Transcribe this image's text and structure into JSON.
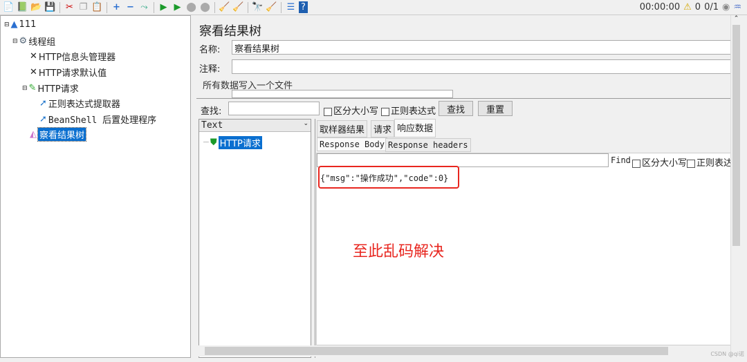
{
  "toolbar": {
    "icons": [
      "new-icon",
      "templates-icon",
      "open-icon",
      "save-icon",
      "cut-icon",
      "copy-icon",
      "paste-icon",
      "expand-icon",
      "collapse-icon",
      "toggle-icon",
      "start-icon",
      "start-no-pause-icon",
      "stop-icon",
      "shutdown-icon",
      "clear-icon",
      "clear-all-icon",
      "search-icon",
      "reset-search-icon",
      "function-helper-icon",
      "help-icon"
    ],
    "timer": "00:00:00",
    "warnings": "0",
    "threads": "0/1"
  },
  "tree": {
    "items": [
      {
        "label": "111",
        "icon": "test-plan-icon"
      },
      {
        "label": "线程组",
        "icon": "thread-group-icon"
      },
      {
        "label": "HTTP信息头管理器",
        "icon": "config-tool-icon"
      },
      {
        "label": "HTTP请求默认值",
        "icon": "config-tool-icon"
      },
      {
        "label": "HTTP请求",
        "icon": "sampler-icon"
      },
      {
        "label": "正则表达式提取器",
        "icon": "post-processor-icon"
      },
      {
        "label": "BeanShell 后置处理程序",
        "icon": "post-processor-icon"
      },
      {
        "label": "察看结果树",
        "icon": "listener-icon",
        "selected": true
      }
    ]
  },
  "panel": {
    "title": "察看结果树",
    "name_label": "名称:",
    "name_value": "察看结果树",
    "comment_label": "注释:",
    "comment_value": "",
    "file_group": "所有数据写入一个文件"
  },
  "search": {
    "label": "查找:",
    "value": "",
    "case_label": "区分大小写",
    "regex_label": "正则表达式",
    "find_button": "查找",
    "reset_button": "重置"
  },
  "results": {
    "renderer": "Text",
    "items": [
      {
        "label": "HTTP请求",
        "status": "success"
      }
    ]
  },
  "tabs": {
    "main": [
      "取样器结果",
      "请求",
      "响应数据"
    ],
    "active": 2,
    "sub": [
      "Response Body",
      "Response headers"
    ],
    "sub_active": 0
  },
  "response": {
    "find_label": "Find",
    "case_label": "区分大小写",
    "regex_label": "正则表达",
    "body": "{\"msg\":\"操作成功\",\"code\":0}"
  },
  "annotation": {
    "text": "至此乱码解决",
    "color": "#e8261f"
  },
  "watermark": "CSDN @qi诺"
}
